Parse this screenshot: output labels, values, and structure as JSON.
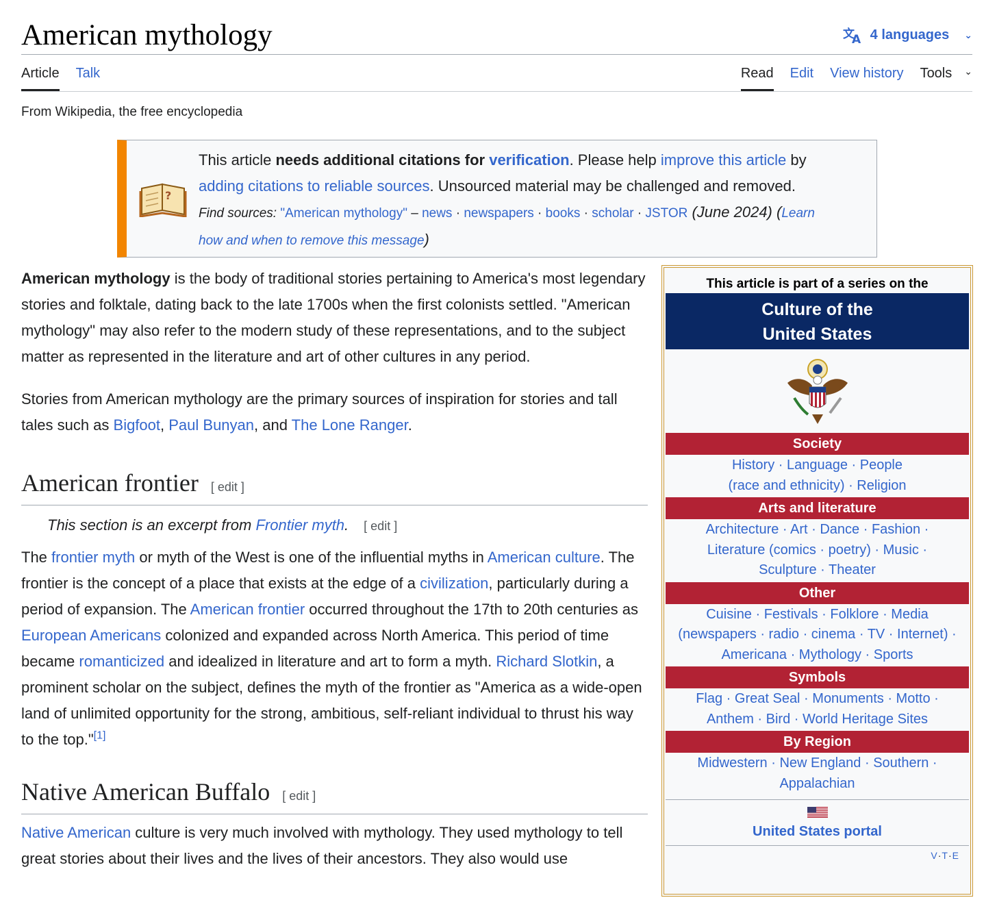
{
  "header": {
    "title": "American mythology",
    "languages_label": "4 languages",
    "tabs_left": [
      "Article",
      "Talk"
    ],
    "tabs_right": [
      "Read",
      "Edit",
      "View history",
      "Tools"
    ],
    "tagline": "From Wikipedia, the free encyclopedia"
  },
  "ambox": {
    "t1": "This article ",
    "t1_bold": "needs additional citations for ",
    "t1_link": "verification",
    "t2": ". Please help ",
    "t2_link": "improve this article",
    "t3": " by",
    "t4_link": "adding citations to reliable sources",
    "t5": ". Unsourced material may be challenged and removed.",
    "find_label": "Find sources:",
    "find_query": "\"American mythology\"",
    "find_dash": " – ",
    "find_links": [
      "news",
      "newspapers",
      "books",
      "scholar",
      "JSTOR"
    ],
    "date": "(June 2024)",
    "learn_open": "(",
    "learn_link_a": "Learn",
    "learn_link_b": "how and when to remove this message",
    "learn_close": ")"
  },
  "intro": {
    "bold": "American mythology",
    "p1_rest": " is the body of traditional stories pertaining to America's most legendary stories and folktale, dating back to the late 1700s when the first colonists settled. \"American mythology\" may also refer to the modern study of these representations, and to the subject matter as represented in the literature and art of other cultures in any period.",
    "p2_a": "Stories from American mythology are the primary sources of inspiration for stories and tall tales such as ",
    "p2_link1": "Bigfoot",
    "p2_b": ", ",
    "p2_link2": "Paul Bunyan",
    "p2_c": ", and ",
    "p2_link3": "The Lone Ranger",
    "p2_d": "."
  },
  "frontier": {
    "heading": "American frontier",
    "edit_label": "[ edit ]",
    "hatnote_text": "This section is an excerpt from ",
    "hatnote_link": "Frontier myth",
    "hatnote_dot": ".",
    "hatnote_edit": "[ edit ]",
    "s1": "The ",
    "l1": "frontier myth",
    "s2": " or myth of the West is one of the influential myths in ",
    "l2": "American culture",
    "s3": ". The frontier is the concept of a place that exists at the edge of a ",
    "l3": "civilization",
    "s4": ", particularly during a period of expansion. The ",
    "l4": "American frontier",
    "s5": " occurred throughout the 17th to 20th centuries as ",
    "l5": "European Americans",
    "s6": " colonized and expanded across North America. This period of time became ",
    "l6": "romanticized",
    "s7": " and idealized in literature and art to form a myth. ",
    "l7": "Richard Slotkin",
    "s8": ", a prominent scholar on the subject, defines the myth of the frontier as \"America as a wide-open land of unlimited opportunity for the strong, ambitious, self-reliant individual to thrust his way to the top.\"",
    "ref": "[1]"
  },
  "buffalo": {
    "heading": "Native American Buffalo",
    "edit_label": "[ edit ]",
    "l1": "Native American",
    "s1": " culture is very much involved with mythology. They used mythology to tell great stories about their lives and the lives of their ancestors. They also would use"
  },
  "sidebar": {
    "pretitle": "This article is part of a series on the",
    "title_line1": "Culture of the",
    "title_line2": "United States",
    "image_icon": "great-seal-eagle",
    "sections": [
      {
        "heading": "Society",
        "lines": [
          "History · Language · People",
          "(race and ethnicity) · Religion"
        ]
      },
      {
        "heading": "Arts and literature",
        "lines": [
          "Architecture · Art · Dance · Fashion ·",
          "Literature (comics · poetry) · Music ·",
          "Sculpture · Theater"
        ]
      },
      {
        "heading": "Other",
        "lines": [
          "Cuisine · Festivals · Folklore · Media",
          "(newspapers · radio · cinema · TV · Internet) ·",
          "Americana · Mythology · Sports"
        ]
      },
      {
        "heading": "Symbols",
        "lines": [
          "Flag · Great Seal · Monuments · Motto ·",
          "Anthem · Bird · World Heritage Sites"
        ]
      },
      {
        "heading": "By Region",
        "lines": [
          "Midwestern · New England · Southern ·",
          "Appalachian"
        ]
      }
    ],
    "portal_icon": "us-flag-icon",
    "portal_label": "United States portal",
    "vte": [
      "V",
      "T",
      "E"
    ]
  },
  "colors": {
    "link": "#3366cc",
    "navy": "#0a2864",
    "red": "#b22234",
    "ambox_bar": "#f28500",
    "sidebar_border": "#cc9933"
  }
}
